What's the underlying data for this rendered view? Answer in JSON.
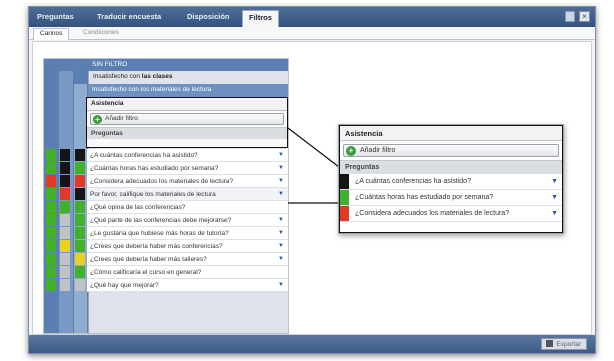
{
  "menu": {
    "items": [
      {
        "label": "Preguntas",
        "active": false
      },
      {
        "label": "Traducir encuesta",
        "active": false
      },
      {
        "label": "Disposición",
        "active": false
      },
      {
        "label": "Filtros",
        "active": true
      }
    ]
  },
  "subtabs": [
    {
      "label": "Carinos",
      "active": true
    },
    {
      "label": "Condiciones",
      "active": false
    }
  ],
  "filter": {
    "no_filter_label": "SIN FILTRO",
    "level1_prefix": "Insatisfecho con ",
    "level1_bold": "las clases",
    "level2_label": "Insatisfecho con los materiales de lectura",
    "group_label": "Asistencia",
    "add_filter_label": "Añadir filtro",
    "questions_header": "Preguntas",
    "questions": [
      "¿A cuántas conferencias ha asistido?",
      "¿Cuántas horas has estudiado por semana?",
      "¿Considera adecuados los materiales de lectura?",
      "Por favor, califique los materiales de lectura",
      "¿Qué opina de las conferencias?",
      "¿Qué parte de las conferencias debe mejorarse?",
      "¿Le gustaría que hubiese más horas de tutoría?",
      "¿Crees que debería haber más conferencias?",
      "¿Crees que debería haber más talleres?",
      "¿Cómo calificaría el curso en general?",
      "¿Qué hay que mejorar?"
    ]
  },
  "callout": {
    "header": "Asistencia",
    "add_filter_label": "Añadir filtro",
    "questions_header": "Preguntas",
    "rows": [
      {
        "text": "¿A cuántas conferencias ha asistido?",
        "color": "#151515"
      },
      {
        "text": "¿Cuántas horas has estudiado por semana?",
        "color": "#43b02a"
      },
      {
        "text": "¿Considera adecuados los materiales de lectura?",
        "color": "#e03a26"
      }
    ]
  },
  "footer": {
    "export_label": "Exportar"
  },
  "colors": {
    "menubar": "#3d5a86",
    "nest_blue_1": "#5b7fb3",
    "nest_blue_2": "#6e91c2",
    "green": "#43b02a",
    "red": "#e03a26",
    "black": "#151515",
    "yellow": "#e8d21f",
    "grey": "#bfc3c8"
  }
}
